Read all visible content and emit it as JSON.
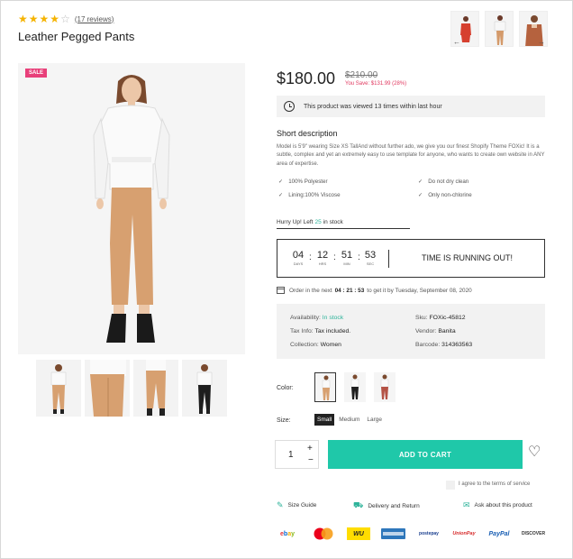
{
  "product": {
    "rating": 4,
    "rating_max": 5,
    "reviews": "(17 reviews)",
    "title": "Leather Pegged Pants",
    "sale_badge": "SALE",
    "price": "$180.00",
    "old_price": "$210.00",
    "you_save": "You Save: $131.99 (28%)"
  },
  "viewed": "This product was viewed 13 times within last hour",
  "short_description": {
    "title": "Short description",
    "text": "Model is 5'9\" wearing Size XS TallAnd without further ado, we give you our finest Shopify Theme FOXic! It is a subtle, complex and yet an extremely easy to use template for anyone, who wants to create own website in ANY area of expertise.",
    "features": [
      "100% Polyester",
      "Do not dry clean",
      "Lining:100% Viscose",
      "Only non-chlorine"
    ]
  },
  "stock": {
    "prefix": "Hurry Up! Left",
    "count": "25",
    "suffix": "in stock"
  },
  "countdown": {
    "days": "04",
    "days_label": "DAYS",
    "hours": "12",
    "hours_label": "HRS",
    "minutes": "51",
    "minutes_label": "MIN",
    "seconds": "53",
    "seconds_label": "SEC",
    "message": "TIME IS RUNNING OUT!"
  },
  "order": {
    "prefix": "Order in the next",
    "time": "04 : 21 : 53",
    "suffix": "to get it by Tuesday, September 08, 2020"
  },
  "info": {
    "availability_label": "Availability:",
    "availability": "In stock",
    "sku_label": "Sku:",
    "sku": "FOXic-45812",
    "tax_label": "Tax Info:",
    "tax": "Tax included.",
    "vendor_label": "Vendor:",
    "vendor": "Banita",
    "collection_label": "Collection:",
    "collection": "Women",
    "barcode_label": "Barcode:",
    "barcode": "314363563"
  },
  "options": {
    "color_label": "Color:",
    "size_label": "Size:",
    "sizes": [
      "Small",
      "Medium",
      "Large"
    ]
  },
  "cart": {
    "quantity": "1",
    "plus": "+",
    "minus": "−",
    "add_label": "ADD TO CART",
    "terms": "I agree to the terms of service"
  },
  "links": {
    "size_guide": "Size Guide",
    "delivery": "Delivery and Return",
    "ask": "Ask about this product"
  },
  "payments": [
    "ebay",
    "mastercard",
    "WU",
    "american express",
    "postepay",
    "UnionPay",
    "PayPal",
    "DISCOVER"
  ],
  "colors": {
    "accent": "#1fc8a9",
    "sale": "#e8407a",
    "star": "#f5b301"
  }
}
